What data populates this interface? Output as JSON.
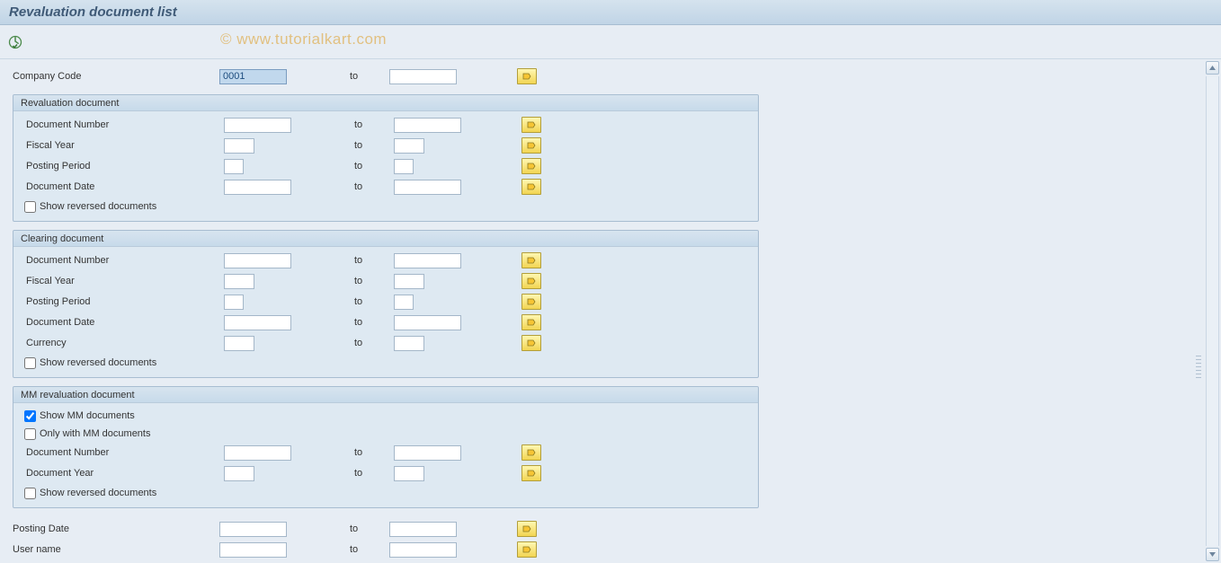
{
  "title": "Revaluation document list",
  "watermark": "© www.tutorialkart.com",
  "to_label": "to",
  "top": {
    "company_code": {
      "label": "Company Code",
      "value": "0001"
    }
  },
  "reval": {
    "header": "Revaluation document",
    "doc_number": {
      "label": "Document Number"
    },
    "fiscal_year": {
      "label": "Fiscal Year"
    },
    "posting_period": {
      "label": "Posting Period"
    },
    "doc_date": {
      "label": "Document Date"
    },
    "show_reversed": {
      "label": "Show reversed documents",
      "checked": false
    }
  },
  "clearing": {
    "header": "Clearing document",
    "doc_number": {
      "label": "Document Number"
    },
    "fiscal_year": {
      "label": "Fiscal Year"
    },
    "posting_period": {
      "label": "Posting Period"
    },
    "doc_date": {
      "label": "Document Date"
    },
    "currency": {
      "label": "Currency"
    },
    "show_reversed": {
      "label": "Show reversed documents",
      "checked": false
    }
  },
  "mm": {
    "header": "MM revaluation document",
    "show_mm": {
      "label": "Show MM documents",
      "checked": true
    },
    "only_with_mm": {
      "label": "Only with MM documents",
      "checked": false
    },
    "doc_number": {
      "label": "Document Number"
    },
    "doc_year": {
      "label": "Document Year"
    },
    "show_reversed": {
      "label": "Show reversed documents",
      "checked": false
    }
  },
  "bottom": {
    "posting_date": {
      "label": "Posting Date"
    },
    "user_name": {
      "label": "User name"
    }
  }
}
